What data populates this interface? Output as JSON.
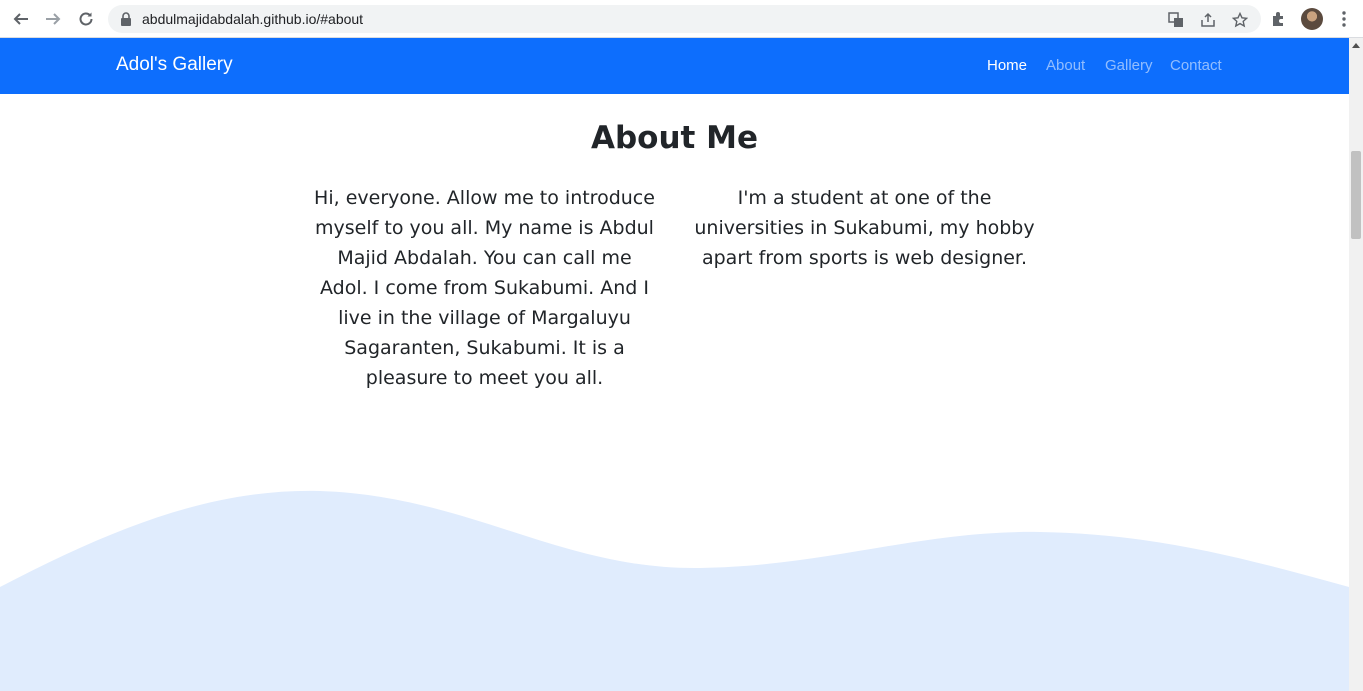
{
  "browser": {
    "url": "abdulmajidabdalah.github.io/#about"
  },
  "site": {
    "brand": "Adol's Gallery",
    "nav": [
      {
        "label": "Home"
      },
      {
        "label": "About"
      },
      {
        "label": "Gallery"
      },
      {
        "label": "Contact"
      }
    ]
  },
  "about": {
    "title": "About Me",
    "paragraph_left": "Hi, everyone. Allow me to introduce myself to you all. My name is Abdul Majid Abdalah. You can call me Adol. I come from Sukabumi. And I live in the village of Margaluyu Sagaranten, Sukabumi. It is a pleasure to meet you all.",
    "paragraph_right": "I'm a student at one of the universities in Sukabumi, my hobby apart from sports is web designer."
  },
  "colors": {
    "navbar": "#0d6efd",
    "wave": "#e0ecfd"
  },
  "icons": [
    "back-arrow-icon",
    "forward-arrow-icon",
    "reload-icon",
    "lock-icon",
    "translate-icon",
    "share-icon",
    "star-icon",
    "extensions-icon",
    "more-vert-icon"
  ]
}
